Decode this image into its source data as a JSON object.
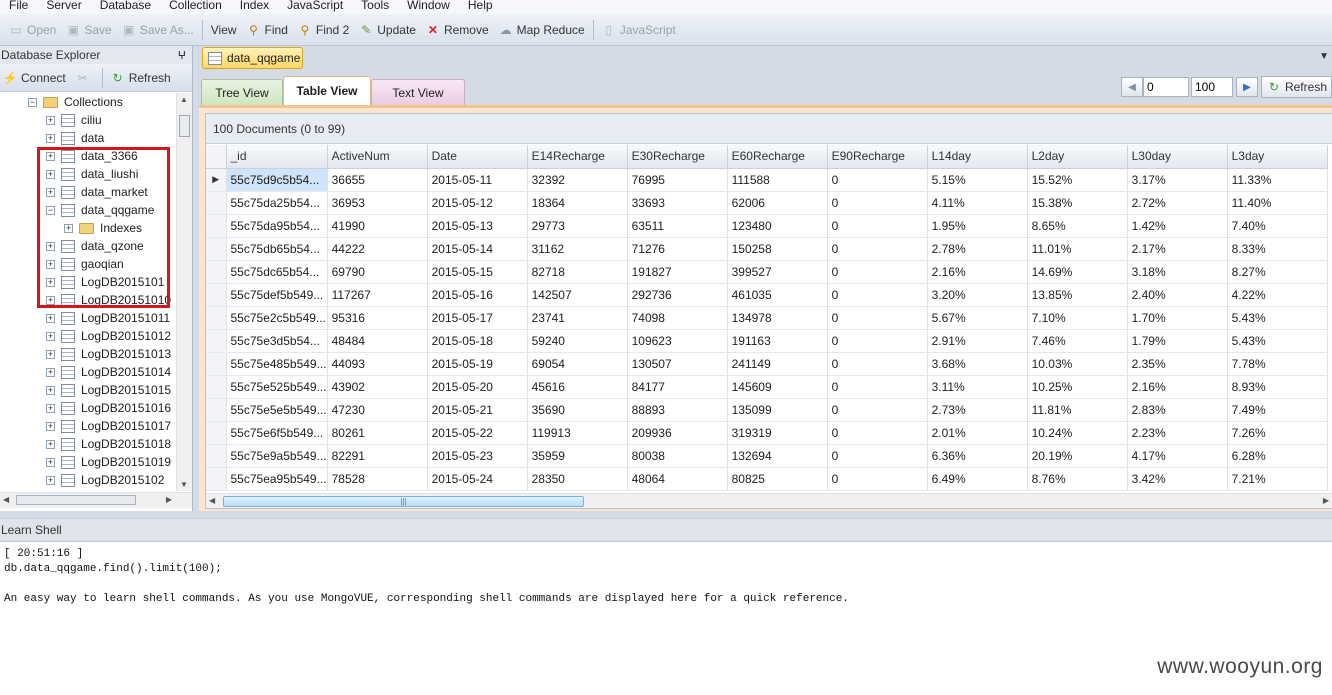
{
  "menu": [
    "File",
    "Server",
    "Database",
    "Collection",
    "Index",
    "JavaScript",
    "Tools",
    "Window",
    "Help"
  ],
  "toolbar": {
    "open": "Open",
    "save": "Save",
    "save_as": "Save As...",
    "view": "View",
    "find": "Find",
    "find2": "Find 2",
    "update": "Update",
    "remove": "Remove",
    "map_reduce": "Map Reduce",
    "javascript": "JavaScript"
  },
  "explorer": {
    "title": "Database Explorer",
    "pin": "ⵖ",
    "connect": "Connect",
    "refresh": "Refresh",
    "collections_label": "Collections",
    "items": [
      "ciliu",
      "data",
      "data_3366",
      "data_liushi",
      "data_market",
      "data_qqgame",
      "data_qzone",
      "gaoqian",
      "LogDB2015101",
      "LogDB20151010",
      "LogDB20151011",
      "LogDB20151012",
      "LogDB20151013",
      "LogDB20151014",
      "LogDB20151015",
      "LogDB20151016",
      "LogDB20151017",
      "LogDB20151018",
      "LogDB20151019",
      "LogDB2015102"
    ],
    "indexes_label": "Indexes"
  },
  "document_tab": "data_qqgame",
  "view_tabs": [
    "Tree View",
    "Table View",
    "Text View"
  ],
  "pager": {
    "skip": "0",
    "limit": "100",
    "refresh": "Refresh"
  },
  "count_text": "100 Documents (0 to 99)",
  "table": {
    "columns": [
      "_id",
      "ActiveNum",
      "Date",
      "E14Recharge",
      "E30Recharge",
      "E60Recharge",
      "E90Recharge",
      "L14day",
      "L2day",
      "L30day",
      "L3day"
    ],
    "rows": [
      [
        "55c75d9c5b54...",
        "36655",
        "2015-05-11",
        "32392",
        "76995",
        "111588",
        "0",
        "5.15%",
        "15.52%",
        "3.17%",
        "11.33%"
      ],
      [
        "55c75da25b54...",
        "36953",
        "2015-05-12",
        "18364",
        "33693",
        "62006",
        "0",
        "4.11%",
        "15.38%",
        "2.72%",
        "11.40%"
      ],
      [
        "55c75da95b54...",
        "41990",
        "2015-05-13",
        "29773",
        "63511",
        "123480",
        "0",
        "1.95%",
        "8.65%",
        "1.42%",
        "7.40%"
      ],
      [
        "55c75db65b54...",
        "44222",
        "2015-05-14",
        "31162",
        "71276",
        "150258",
        "0",
        "2.78%",
        "11.01%",
        "2.17%",
        "8.33%"
      ],
      [
        "55c75dc65b54...",
        "69790",
        "2015-05-15",
        "82718",
        "191827",
        "399527",
        "0",
        "2.16%",
        "14.69%",
        "3.18%",
        "8.27%"
      ],
      [
        "55c75def5b549...",
        "117267",
        "2015-05-16",
        "142507",
        "292736",
        "461035",
        "0",
        "3.20%",
        "13.85%",
        "2.40%",
        "4.22%"
      ],
      [
        "55c75e2c5b549...",
        "95316",
        "2015-05-17",
        "23741",
        "74098",
        "134978",
        "0",
        "5.67%",
        "7.10%",
        "1.70%",
        "5.43%"
      ],
      [
        "55c75e3d5b54...",
        "48484",
        "2015-05-18",
        "59240",
        "109623",
        "191163",
        "0",
        "2.91%",
        "7.46%",
        "1.79%",
        "5.43%"
      ],
      [
        "55c75e485b549...",
        "44093",
        "2015-05-19",
        "69054",
        "130507",
        "241149",
        "0",
        "3.68%",
        "10.03%",
        "2.35%",
        "7.78%"
      ],
      [
        "55c75e525b549...",
        "43902",
        "2015-05-20",
        "45616",
        "84177",
        "145609",
        "0",
        "3.11%",
        "10.25%",
        "2.16%",
        "8.93%"
      ],
      [
        "55c75e5e5b549...",
        "47230",
        "2015-05-21",
        "35690",
        "88893",
        "135099",
        "0",
        "2.73%",
        "11.81%",
        "2.83%",
        "7.49%"
      ],
      [
        "55c75e6f5b549...",
        "80261",
        "2015-05-22",
        "119913",
        "209936",
        "319319",
        "0",
        "2.01%",
        "10.24%",
        "2.23%",
        "7.26%"
      ],
      [
        "55c75e9a5b549...",
        "82291",
        "2015-05-23",
        "35959",
        "80038",
        "132694",
        "0",
        "6.36%",
        "20.19%",
        "4.17%",
        "6.28%"
      ],
      [
        "55c75ea95b549...",
        "78528",
        "2015-05-24",
        "28350",
        "48064",
        "80825",
        "0",
        "6.49%",
        "8.76%",
        "3.42%",
        "7.21%"
      ]
    ]
  },
  "shell": {
    "title": "Learn Shell",
    "lines": [
      "[ 20:51:16 ]",
      "db.data_qqgame.find().limit(100);",
      "",
      "An easy way to learn shell commands. As you use MongoVUE, corresponding shell commands are displayed here for a quick reference."
    ]
  },
  "watermark": "www.wooyun.org"
}
